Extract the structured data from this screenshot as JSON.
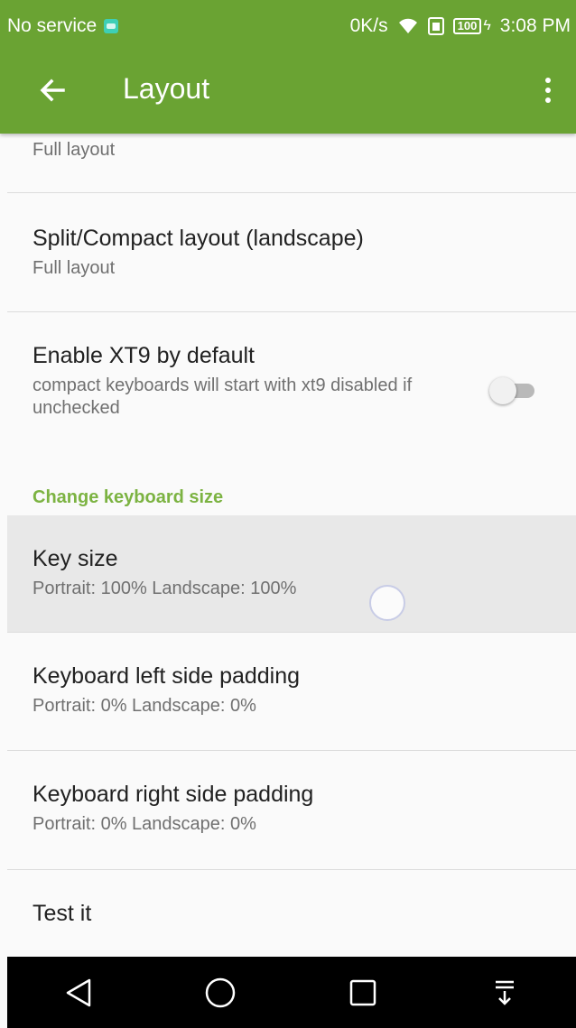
{
  "status_bar": {
    "carrier": "No service",
    "net_speed": "0K/s",
    "battery": "100",
    "time": "3:08 PM",
    "icons": [
      "android-notification-icon",
      "wifi-icon",
      "sim-icon",
      "battery-icon",
      "charging-bolt-icon"
    ]
  },
  "app_bar": {
    "title": "Layout",
    "back_icon": "arrow-left-icon",
    "menu_icon": "overflow-menu-icon",
    "color": "#6aa333"
  },
  "list": {
    "partial_item": {
      "summary": "Full layout"
    },
    "items": [
      {
        "title": "Split/Compact layout (landscape)",
        "summary": "Full layout"
      },
      {
        "title": "Enable XT9 by default",
        "summary": "compact keyboards will start with xt9 disabled if unchecked",
        "toggle_on": false
      }
    ],
    "section_header": "Change keyboard size",
    "size_items": [
      {
        "title": "Key size",
        "summary": "Portrait: 100% Landscape: 100%",
        "pressed": true
      },
      {
        "title": "Keyboard left side padding",
        "summary": "Portrait: 0% Landscape: 0%"
      },
      {
        "title": "Keyboard right side padding",
        "summary": "Portrait: 0% Landscape: 0%"
      },
      {
        "title": "Test it"
      }
    ]
  },
  "nav_bar": {
    "icons": [
      "back-triangle-icon",
      "home-circle-icon",
      "recents-square-icon",
      "notification-pull-icon"
    ]
  },
  "accent_color": "#7cb342"
}
